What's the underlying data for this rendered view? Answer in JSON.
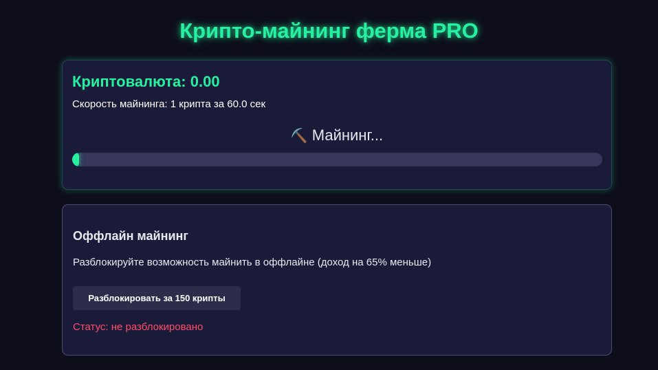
{
  "app": {
    "title": "Крипто-майнинг ферма PRO"
  },
  "stats": {
    "balance_text": "Криптовалюта: 0.00",
    "speed_text": "Скорость майнинга: 1 крипта за 60.0 сек"
  },
  "mining": {
    "icon": "pickaxe-icon",
    "icon_glyph": "⛏️",
    "status_label": "Майнинг...",
    "progress_fraction": 0.0
  },
  "offline": {
    "title": "Оффлайн майнинг",
    "description": "Разблокируйте возможность майнить в оффлайне (доход на 65% меньше)",
    "button_label": "Разблокировать за 150 крипты",
    "status_text": "Статус: не разблокировано"
  },
  "colors": {
    "accent": "#27f0a0",
    "background": "#0e0e1a",
    "panel": "#1a1b38",
    "status_error": "#ff4d6a"
  }
}
